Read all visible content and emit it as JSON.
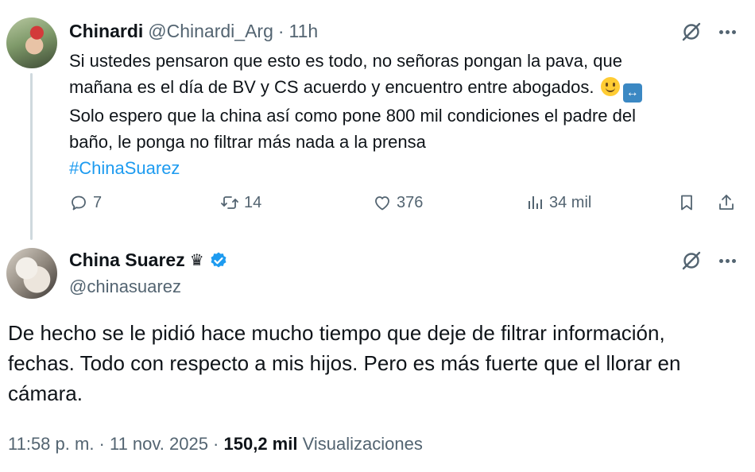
{
  "reply_parent": {
    "author_name": "Chinardi",
    "author_handle": "@Chinardi_Arg",
    "separator": "·",
    "time_ago": "11h",
    "lines": [
      "Si ustedes pensaron que esto es todo, no señoras pongan la pava, que",
      "mañana es el día de BV y CS acuerdo y encuentro entre abogados.",
      "Solo espero que la china así como pone 800 mil condiciones el padre del",
      "baño, le ponga no filtrar más nada a la prensa"
    ],
    "emojis": [
      "slightly-smiling-face",
      "left-right-arrow"
    ],
    "hashtag": "#ChinaSuarez",
    "stats": {
      "replies": "7",
      "reposts": "14",
      "likes": "376",
      "views": "34 mil"
    }
  },
  "main_tweet": {
    "author_name": "China Suarez",
    "crown": "♛",
    "verified": true,
    "author_handle": "@chinasuarez",
    "lines": [
      "De hecho se le pidió hace mucho tiempo que deje de filtrar información,",
      "fechas. Todo con respecto a mis hijos. Pero es más fuerte que el llorar en",
      "cámara."
    ],
    "timestamp": "11:58 p. m. · 11 nov. 2025 ·",
    "views_count": "150,2 mil",
    "views_label": "Visualizaciones"
  },
  "colors": {
    "text": "#0f1419",
    "secondary": "#536471",
    "link": "#1d9bf0",
    "verified": "#1d9bf0",
    "thread_line": "#cfd9de"
  },
  "icons": [
    "grok-icon",
    "more-icon",
    "reply-icon",
    "repost-icon",
    "like-icon",
    "views-icon",
    "bookmark-icon",
    "share-icon",
    "verified-icon"
  ]
}
